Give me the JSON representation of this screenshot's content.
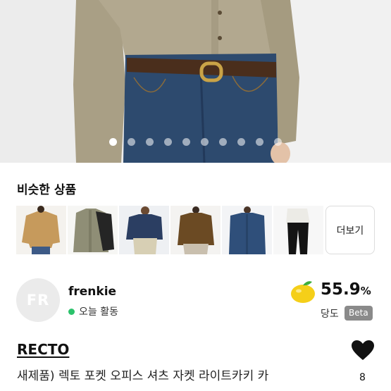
{
  "hero": {
    "image": "product-photo-shirt-jacket-with-jeans",
    "carousel_dot_count": 10,
    "carousel_active_index": 0
  },
  "similar_products": {
    "title": "비슷한 상품",
    "items": [
      {
        "image": "tan-shirt-jacket"
      },
      {
        "image": "olive-shirt-jacket"
      },
      {
        "image": "navy-denim-shirt"
      },
      {
        "image": "brown-corduroy-jacket"
      },
      {
        "image": "blue-denim-shirt"
      },
      {
        "image": "white-shirt-black-pants"
      }
    ],
    "more_label": "더보기"
  },
  "seller": {
    "avatar_initials": "FR",
    "name": "frenkie",
    "status": "오늘 활동",
    "status_color": "#2bc26b",
    "rating_value": "55.9",
    "rating_unit": "%",
    "rating_label": "당도",
    "rating_badge": "Beta",
    "rating_icon": "lemon-icon"
  },
  "product": {
    "brand": "RECTO",
    "title": "새제품) 렉토 포켓 오피스 셔츠 자켓 라이트카키 카",
    "like_count": "8",
    "like_icon": "heart-icon"
  }
}
